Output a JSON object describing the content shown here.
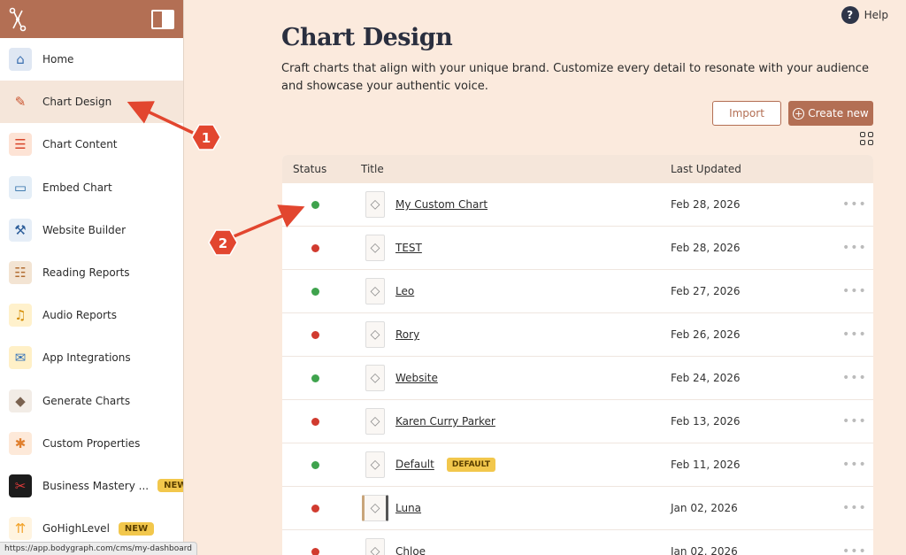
{
  "sidebar": {
    "items": [
      {
        "label": "Home",
        "icon": "home-icon",
        "glyph": "⌂",
        "bg": "#dfe7f3",
        "fg": "#3b6fb0"
      },
      {
        "label": "Chart Design",
        "icon": "chart-design-icon",
        "glyph": "✎",
        "bg": "#f5e6da",
        "fg": "#c9542f",
        "active": true
      },
      {
        "label": "Chart Content",
        "icon": "chart-content-icon",
        "glyph": "☰",
        "bg": "#fde3d5",
        "fg": "#d8452a"
      },
      {
        "label": "Embed Chart",
        "icon": "embed-chart-icon",
        "glyph": "▭",
        "bg": "#e4eef7",
        "fg": "#2f6fa8"
      },
      {
        "label": "Website Builder",
        "icon": "website-builder-icon",
        "glyph": "⚒",
        "bg": "#e6eef7",
        "fg": "#2d5e9a"
      },
      {
        "label": "Reading Reports",
        "icon": "reading-reports-icon",
        "glyph": "☷",
        "bg": "#f3e4d3",
        "fg": "#b26d32"
      },
      {
        "label": "Audio Reports",
        "icon": "audio-reports-icon",
        "glyph": "♫",
        "bg": "#fff1cc",
        "fg": "#d38a00"
      },
      {
        "label": "App Integrations",
        "icon": "app-integrations-icon",
        "glyph": "✉",
        "bg": "#fff0c7",
        "fg": "#3170b9"
      },
      {
        "label": "Generate Charts",
        "icon": "generate-charts-icon",
        "glyph": "◆",
        "bg": "#f2ece6",
        "fg": "#7a6250"
      },
      {
        "label": "Custom Properties",
        "icon": "custom-properties-icon",
        "glyph": "✱",
        "bg": "#fde9d9",
        "fg": "#e07f2e"
      },
      {
        "label": "Business Mastery ...",
        "icon": "business-mastery-icon",
        "glyph": "✂",
        "bg": "#1c1c1c",
        "fg": "#e03a3a",
        "badge": "NEW"
      },
      {
        "label": "GoHighLevel",
        "icon": "gohighlevel-icon",
        "glyph": "⇈",
        "bg": "#fff4e0",
        "fg": "#f2a32a",
        "badge": "NEW"
      }
    ]
  },
  "status_url": "https://app.bodygraph.com/cms/my-dashboard",
  "help_label": "Help",
  "page": {
    "title": "Chart Design",
    "description": "Craft charts that align with your unique brand. Customize every detail to resonate with your audience and showcase your authentic voice.",
    "import_label": "Import",
    "create_label": "Create new"
  },
  "table": {
    "headers": {
      "status": "Status",
      "title": "Title",
      "updated": "Last Updated"
    },
    "rows": [
      {
        "status": "active",
        "title": "My Custom Chart",
        "date": "Feb 28, 2026"
      },
      {
        "status": "inactive",
        "title": "TEST",
        "date": "Feb 28, 2026"
      },
      {
        "status": "active",
        "title": "Leo",
        "date": "Feb 27, 2026"
      },
      {
        "status": "inactive",
        "title": "Rory",
        "date": "Feb 26, 2026"
      },
      {
        "status": "active",
        "title": "Website",
        "date": "Feb 24, 2026"
      },
      {
        "status": "inactive",
        "title": "Karen Curry Parker",
        "date": "Feb 13, 2026"
      },
      {
        "status": "active",
        "title": "Default",
        "date": "Feb 11, 2026",
        "badge": "DEFAULT"
      },
      {
        "status": "inactive",
        "title": "Luna",
        "date": "Jan 02, 2026",
        "framed": true
      },
      {
        "status": "inactive",
        "title": "Chloe",
        "date": "Jan 02, 2026"
      }
    ]
  },
  "annotations": [
    "1",
    "2"
  ],
  "colors": {
    "accent": "#b36f54",
    "active_status": "#3fa34d",
    "inactive_status": "#d13b2f",
    "annotation": "#e2462f",
    "badge": "#f2c74c"
  }
}
